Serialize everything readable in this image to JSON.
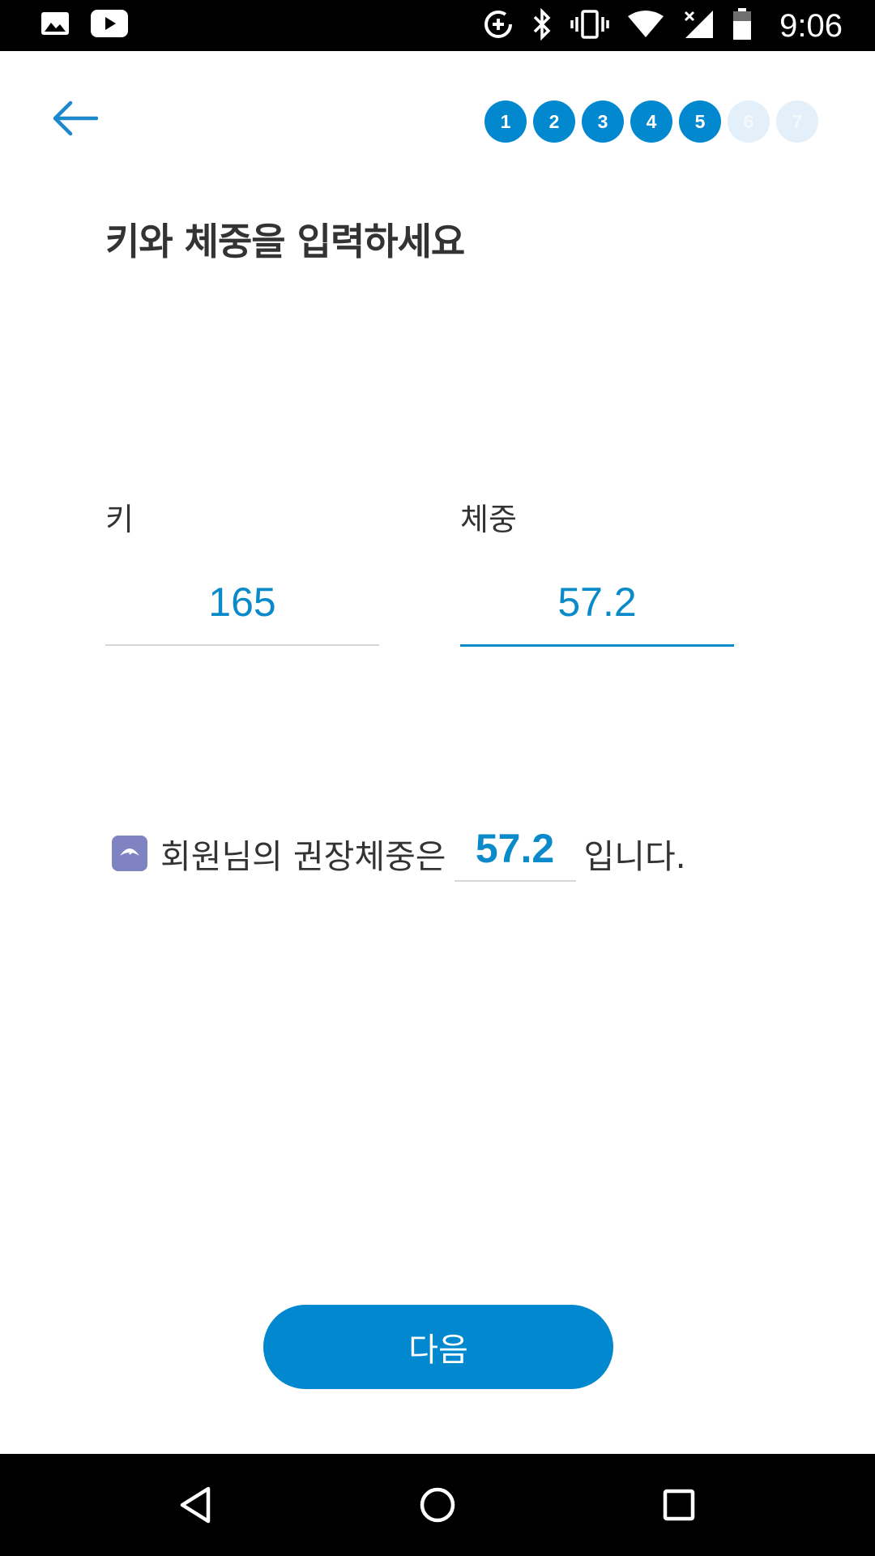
{
  "status_bar": {
    "time": "9:06",
    "left_icons": [
      "image-icon",
      "youtube-icon"
    ],
    "right_icons": [
      "data-saver-icon",
      "bluetooth-icon",
      "vibrate-icon",
      "wifi-icon",
      "cell-signal-icon",
      "battery-icon"
    ]
  },
  "header": {
    "back_icon": "arrow-left-icon",
    "steps": [
      {
        "label": "1",
        "state": "done"
      },
      {
        "label": "2",
        "state": "done"
      },
      {
        "label": "3",
        "state": "done"
      },
      {
        "label": "4",
        "state": "done"
      },
      {
        "label": "5",
        "state": "done"
      },
      {
        "label": "6",
        "state": "todo"
      },
      {
        "label": "7",
        "state": "todo"
      }
    ]
  },
  "page": {
    "title": "키와 체중을 입력하세요"
  },
  "form": {
    "height_label": "키",
    "height_value": "165",
    "weight_label": "체중",
    "weight_value": "57.2"
  },
  "recommendation": {
    "icon": "scale-icon",
    "prefix": "회원님의 권장체중은",
    "value": "57.2",
    "suffix": "입니다."
  },
  "actions": {
    "next_label": "다음"
  },
  "nav_bar": {
    "icons": [
      "back-triangle-icon",
      "home-circle-icon",
      "recents-square-icon"
    ]
  },
  "colors": {
    "accent": "#0288cf",
    "accent_text": "#0a8ac8",
    "step_inactive": "#e3f0fa",
    "scale_icon_bg": "#7f83c2"
  }
}
